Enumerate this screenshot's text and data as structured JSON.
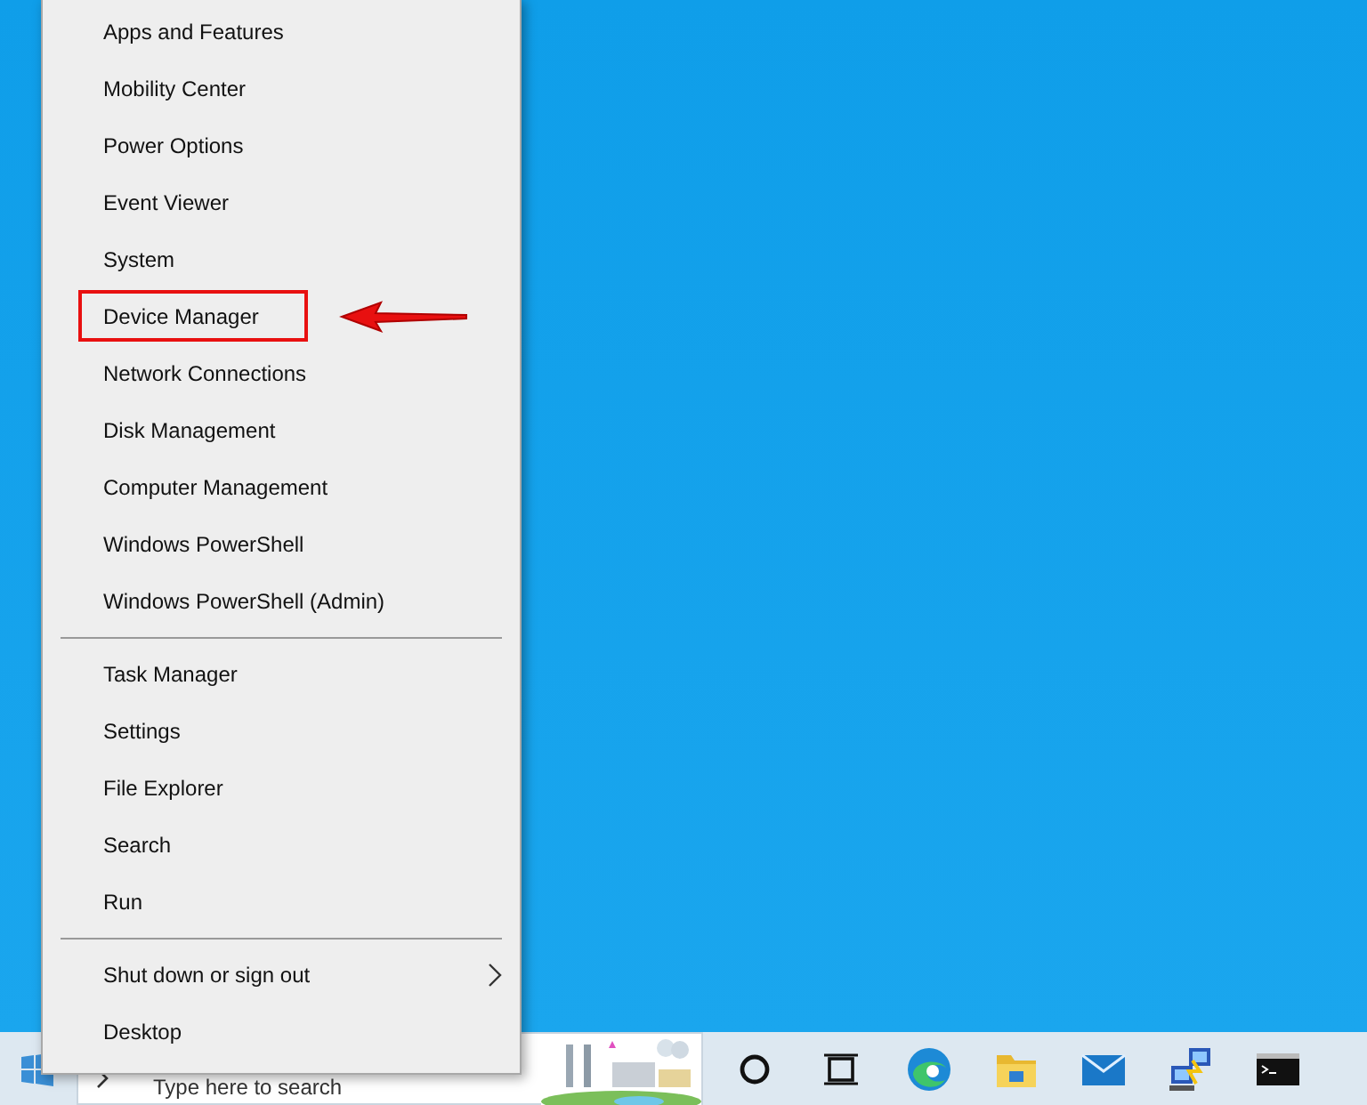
{
  "menu": {
    "groups": [
      {
        "items": [
          {
            "label": "Apps and Features",
            "submenu": false,
            "highlighted": false
          },
          {
            "label": "Mobility Center",
            "submenu": false,
            "highlighted": false
          },
          {
            "label": "Power Options",
            "submenu": false,
            "highlighted": false
          },
          {
            "label": "Event Viewer",
            "submenu": false,
            "highlighted": false
          },
          {
            "label": "System",
            "submenu": false,
            "highlighted": false
          },
          {
            "label": "Device Manager",
            "submenu": false,
            "highlighted": true
          },
          {
            "label": "Network Connections",
            "submenu": false,
            "highlighted": false
          },
          {
            "label": "Disk Management",
            "submenu": false,
            "highlighted": false
          },
          {
            "label": "Computer Management",
            "submenu": false,
            "highlighted": false
          },
          {
            "label": "Windows PowerShell",
            "submenu": false,
            "highlighted": false
          },
          {
            "label": "Windows PowerShell (Admin)",
            "submenu": false,
            "highlighted": false
          }
        ]
      },
      {
        "items": [
          {
            "label": "Task Manager",
            "submenu": false,
            "highlighted": false
          },
          {
            "label": "Settings",
            "submenu": false,
            "highlighted": false
          },
          {
            "label": "File Explorer",
            "submenu": false,
            "highlighted": false
          },
          {
            "label": "Search",
            "submenu": false,
            "highlighted": false
          },
          {
            "label": "Run",
            "submenu": false,
            "highlighted": false
          }
        ]
      },
      {
        "items": [
          {
            "label": "Shut down or sign out",
            "submenu": true,
            "highlighted": false
          },
          {
            "label": "Desktop",
            "submenu": false,
            "highlighted": false
          }
        ]
      }
    ]
  },
  "taskbar": {
    "search": {
      "placeholder": "Type here to search"
    },
    "apps": [
      {
        "kind": "cortana"
      },
      {
        "kind": "taskview"
      },
      {
        "kind": "edge"
      },
      {
        "kind": "explorer"
      },
      {
        "kind": "mail"
      },
      {
        "kind": "network"
      },
      {
        "kind": "terminal"
      }
    ]
  }
}
